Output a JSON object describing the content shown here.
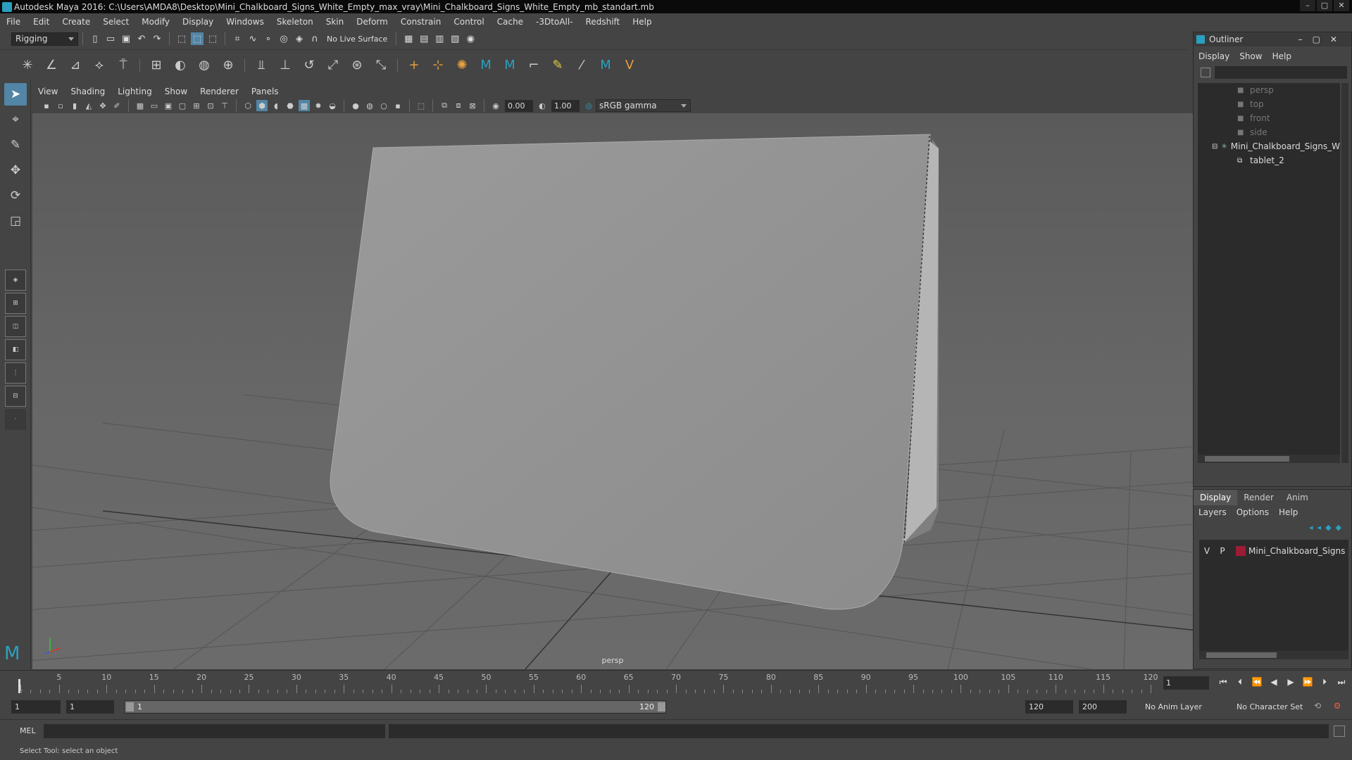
{
  "window": {
    "title": "Autodesk Maya 2016: C:\\Users\\AMDA8\\Desktop\\Mini_Chalkboard_Signs_White_Empty_max_vray\\Mini_Chalkboard_Signs_White_Empty_mb_standart.mb",
    "minimize": "–",
    "maximize": "▢",
    "close": "✕"
  },
  "menubar": [
    "File",
    "Edit",
    "Create",
    "Select",
    "Modify",
    "Display",
    "Windows",
    "Skeleton",
    "Skin",
    "Deform",
    "Constrain",
    "Control",
    "Cache",
    "-3DtoAll-",
    "Redshift",
    "Help"
  ],
  "statusline": {
    "menuset": "Rigging",
    "live_surface": "No Live Surface"
  },
  "panel": {
    "menu": [
      "View",
      "Shading",
      "Lighting",
      "Show",
      "Renderer",
      "Panels"
    ],
    "exposure": "0.00",
    "gamma_value": "1.00",
    "colorspace": "sRGB gamma",
    "camera_label": "persp"
  },
  "outliner": {
    "title": "Outliner",
    "menu": [
      "Display",
      "Show",
      "Help"
    ],
    "items": [
      {
        "label": "persp",
        "type": "camera"
      },
      {
        "label": "top",
        "type": "camera"
      },
      {
        "label": "front",
        "type": "camera"
      },
      {
        "label": "side",
        "type": "camera"
      },
      {
        "label": "Mini_Chalkboard_Signs_W",
        "type": "group"
      },
      {
        "label": "tablet_2",
        "type": "mesh"
      }
    ]
  },
  "layer_editor": {
    "tabs": [
      "Display",
      "Render",
      "Anim"
    ],
    "active_tab": "Display",
    "menu": [
      "Layers",
      "Options",
      "Help"
    ],
    "layers": [
      {
        "v": "V",
        "p": "P",
        "name": "Mini_Chalkboard_Signs",
        "color": "#9c1c35"
      }
    ]
  },
  "timeslider": {
    "ticks": [
      "5",
      "10",
      "15",
      "20",
      "25",
      "30",
      "35",
      "40",
      "45",
      "50",
      "55",
      "60",
      "65",
      "70",
      "75",
      "80",
      "85",
      "90",
      "95",
      "100",
      "105",
      "110",
      "115",
      "120"
    ],
    "start_tick": "1",
    "current_frame": "1"
  },
  "range": {
    "start": "1",
    "playback_start": "1",
    "bar_start": "1",
    "bar_end": "120",
    "playback_end": "120",
    "end": "200",
    "anim_layer": "No Anim Layer",
    "character_set": "No Character Set"
  },
  "cmdline": {
    "label": "MEL"
  },
  "helpline": {
    "text": "Select Tool: select an object"
  }
}
